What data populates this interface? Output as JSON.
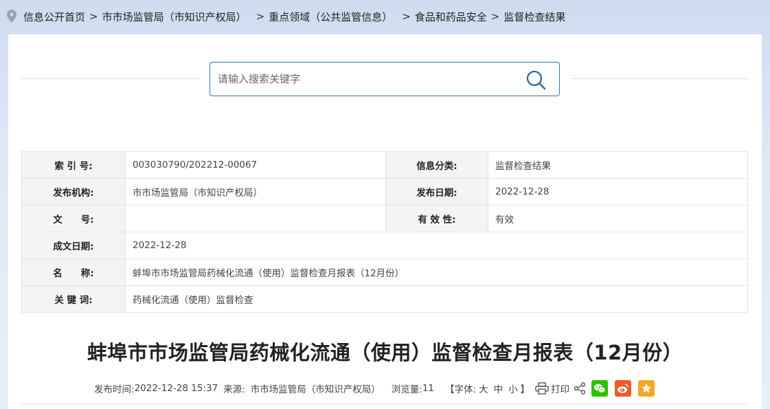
{
  "breadcrumb": {
    "items": [
      "信息公开首页",
      "市市场监管局（市知识产权局）",
      "重点领域（公共监管信息）",
      "食品和药品安全",
      "监督检查结果"
    ],
    "separator": ">"
  },
  "search": {
    "placeholder": "请输入搜索关键字"
  },
  "meta": {
    "index_label": "索 引 号:",
    "index_value": "003030790/202212-00067",
    "category_label": "信息分类:",
    "category_value": "监督检查结果",
    "publisher_label": "发布机构:",
    "publisher_value": "市市场监管局（市知识产权局）",
    "pubdate_label": "发布日期:",
    "pubdate_value": "2022-12-28",
    "docno_label": "文　　号:",
    "docno_value": "",
    "validity_label": "有 效 性:",
    "validity_value": "有效",
    "created_label": "成文日期:",
    "created_value": "2022-12-28",
    "name_label": "名　　称:",
    "name_value": "蚌埠市市场监管局药械化流通（使用）监督检查月报表（12月份）",
    "keywords_label": "关 键 词:",
    "keywords_value": "药械化流通（使用）监督检查"
  },
  "article": {
    "title": "蚌埠市市场监管局药械化流通（使用）监督检查月报表（12月份）"
  },
  "info": {
    "time_label": "发布时间:",
    "time_value": "2022-12-28 15:37",
    "source_label": "来源:",
    "source_value": "市市场监管局（市知识产权局）",
    "views_label": "浏览量:",
    "views_value": "11",
    "font_open": "【字体:",
    "font_large": "大",
    "font_medium": "中",
    "font_small": "小",
    "font_close": "】",
    "print_label": "打印"
  },
  "colors": {
    "wechat": "#2dc100",
    "weibo": "#f05a28",
    "favorite": "#f6a623"
  }
}
